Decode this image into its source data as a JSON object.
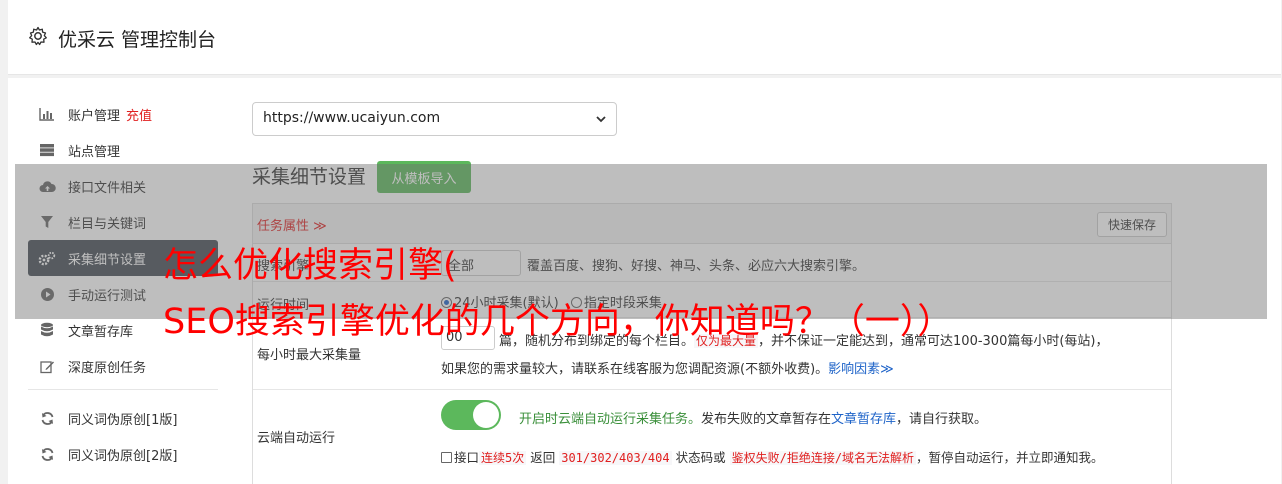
{
  "header": {
    "title": "优采云 管理控制台",
    "icon": "gear-icon"
  },
  "sidebar": {
    "items": [
      {
        "label": "账户管理",
        "extra": "充值",
        "icon": "bar-chart-icon"
      },
      {
        "label": "站点管理",
        "icon": "server-icon"
      },
      {
        "label": "接口文件相关",
        "icon": "cloud-upload-icon"
      },
      {
        "label": "栏目与关键词",
        "icon": "filter-icon"
      },
      {
        "label": "采集细节设置",
        "icon": "cogs-icon",
        "active": true
      },
      {
        "label": "手动运行测试",
        "icon": "play-circle-icon"
      },
      {
        "label": "文章暂存库",
        "icon": "database-icon"
      },
      {
        "label": "深度原创任务",
        "icon": "edit-icon"
      },
      {
        "label": "同义词伪原创[1版]",
        "icon": "refresh-icon"
      },
      {
        "label": "同义词伪原创[2版]",
        "icon": "refresh-icon"
      }
    ]
  },
  "site_select": {
    "value": "https://www.ucaiyun.com"
  },
  "section": {
    "title": "采集细节设置",
    "import_button": "从模板导入"
  },
  "panel": {
    "task_attr": "任务属性 ≫",
    "save_button": "快速保存",
    "engine_row": {
      "label": "搜索引擎",
      "select_value": "全部",
      "desc": "覆盖百度、搜狗、好搜、神马、头条、必应六大搜索引擎。"
    },
    "time_row": {
      "label": "运行时间",
      "option1": "24小时采集(默认)",
      "option2": "指定时段采集"
    },
    "max_row": {
      "label": "每小时最大采集量",
      "value": "00",
      "line1_a": "篇，随机分布到绑定的每个栏目。",
      "line1_b": "仅为最大量",
      "line1_c": "，并不保证一定能达到，通常可达100-300篇每小时(每站)，",
      "line2": "如果您的需求量较大，请联系在线客服为您调配资源(不额外收费)。",
      "link": "影响因素≫"
    },
    "cloud_row": {
      "label": "云端自动运行",
      "toggle_on": true,
      "green_text": "开启时云端自动运行采集任务。",
      "text_a": "发布失败的文章暂存在",
      "link": "文章暂存库",
      "text_b": "，请自行获取。",
      "cb_label": "接口",
      "code1": "连续5次",
      "t1": "返回",
      "code2": "301/302/403/404",
      "t2": "状态码或",
      "code3": "鉴权失败/拒绝连接/域名无法解析",
      "t3": "，暂停自动运行，并立即通知我。"
    }
  },
  "overlay": {
    "line1": "怎么优化搜索引擎(",
    "line2": "SEO搜索引擎优化的几个方向，你知道吗？（一））"
  },
  "colors": {
    "accent_green": "#5cb85c",
    "active_bg": "#444c55",
    "red": "#e02020",
    "link_blue": "#1e63c8",
    "overlay_red": "#ff0000"
  }
}
